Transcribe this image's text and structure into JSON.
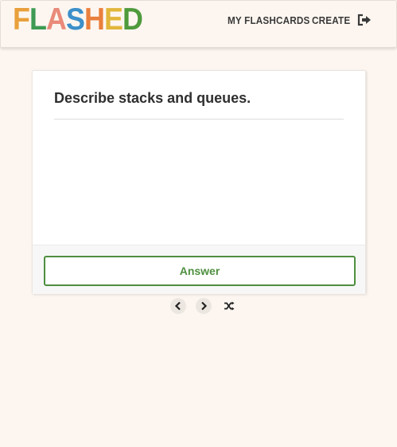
{
  "logo": {
    "letters": [
      {
        "char": "F",
        "color": "#e9a03c"
      },
      {
        "char": "L",
        "color": "#3e9a52"
      },
      {
        "char": "A",
        "color": "#e98a7a"
      },
      {
        "char": "S",
        "color": "#3c8fc9"
      },
      {
        "char": "H",
        "color": "#e97f3c"
      },
      {
        "char": "E",
        "color": "#e2b63a"
      },
      {
        "char": "D",
        "color": "#4e9a3c"
      }
    ]
  },
  "nav": {
    "my_flashcards": "MY FLASHCARDS",
    "create": "CREATE",
    "logout_icon": "sign-out-icon"
  },
  "card": {
    "question": "Describe stacks and queues.",
    "answer_button": "Answer"
  },
  "controls": {
    "prev_icon": "chevron-left-icon",
    "next_icon": "chevron-right-icon",
    "shuffle_icon": "shuffle-icon"
  },
  "colors": {
    "accent_green": "#4e8f3f",
    "background": "#fdf6f0"
  }
}
